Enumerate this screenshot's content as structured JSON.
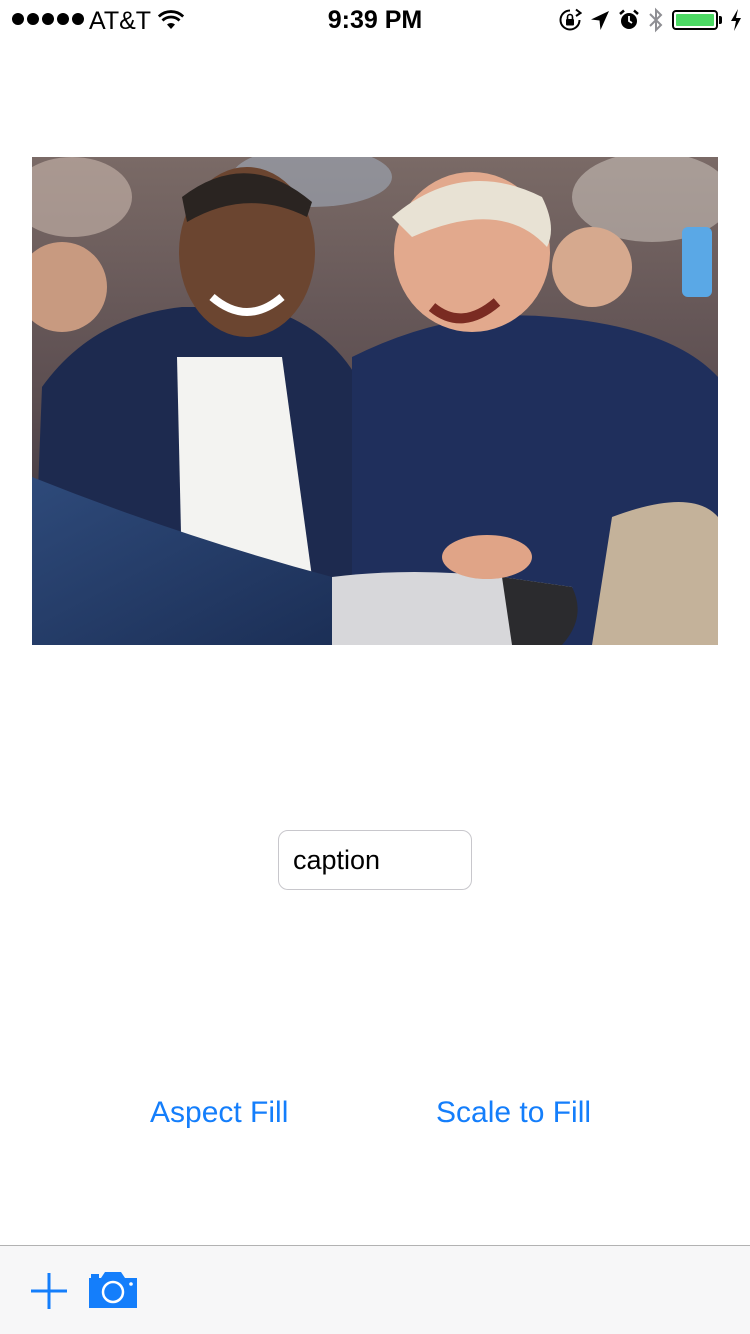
{
  "status_bar": {
    "carrier": "AT&T",
    "time": "9:39 PM",
    "battery_level": 1.0,
    "icons": [
      "signal-dots",
      "wifi-icon",
      "orientation-lock-icon",
      "location-arrow-icon",
      "alarm-icon",
      "bluetooth-icon",
      "battery-icon",
      "charging-bolt-icon"
    ]
  },
  "photo": {
    "icon": "photo"
  },
  "caption": {
    "value": "caption"
  },
  "buttons": {
    "aspect_fill": "Aspect Fill",
    "scale_to_fill": "Scale to Fill"
  },
  "toolbar": {
    "add_icon": "plus-icon",
    "camera_icon": "camera-icon"
  },
  "colors": {
    "tint": "#147efb",
    "battery": "#4cd964",
    "toolbar_bg": "#f7f7f8"
  }
}
